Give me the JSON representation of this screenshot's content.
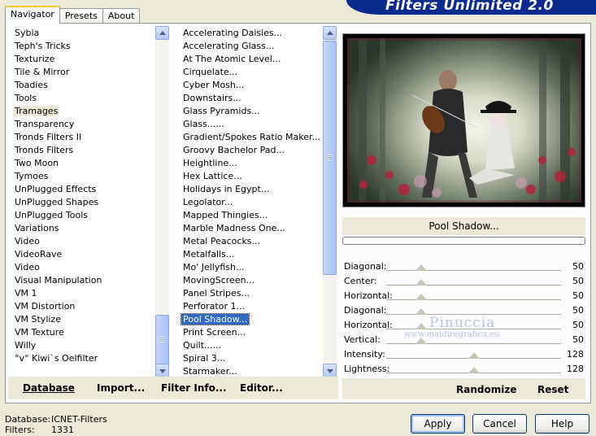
{
  "banner": {
    "title": "Filters Unlimited 2.0"
  },
  "tabs": [
    "Navigator",
    "Presets",
    "About"
  ],
  "categories": [
    "Sybia",
    "Teph's Tricks",
    "Texturize",
    "Tile & Mirror",
    "Toadies",
    "Tools",
    "Tramages",
    "Transparency",
    "Tronds Filters II",
    "Tronds Filters",
    "Two Moon",
    "Tymoes",
    "UnPlugged Effects",
    "UnPlugged Shapes",
    "UnPlugged Tools",
    "Variations",
    "Video",
    "VideoRave",
    "Video",
    "Visual Manipulation",
    "VM 1",
    "VM Distortion",
    "VM Stylize",
    "VM Texture",
    "Willy",
    "°v° Kiwi`s Oelfilter"
  ],
  "selected_category": "Tramages",
  "filters": [
    "Accelerating Daisies...",
    "Accelerating Glass...",
    "At The Atomic Level...",
    "Cirquelate...",
    "Cyber Mosh...",
    "Downstairs...",
    "Glass Pyramids...",
    "Glass......",
    "Gradient/Spokes Ratio Maker...",
    "Groovy Bachelor Pad...",
    "Heightline...",
    "Hex Lattice...",
    "Holidays in Egypt...",
    "Legolator...",
    "Mapped Thingies...",
    "Marble Madness One...",
    "Metal Peacocks...",
    "Metalfalls...",
    "Mo' Jellyfish...",
    "MovingScreen...",
    "Panel Stripes...",
    "Perforator 1...",
    "Pool Shadow...",
    "Print Screen...",
    "Quilt......",
    "Spiral 3...",
    "Starmaker..."
  ],
  "selected_filter": "Pool Shadow...",
  "left_buttons": {
    "database": "Database",
    "import": "Import...",
    "filter_info": "Filter Info...",
    "editor": "Editor..."
  },
  "preview": {
    "filter_name": "Pool Shadow..."
  },
  "params": [
    {
      "label": "Diagonal:",
      "value": "50",
      "level": 0.2
    },
    {
      "label": "Center:",
      "value": "50",
      "level": 0.2
    },
    {
      "label": "Horizontal:",
      "value": "50",
      "level": 0.2
    },
    {
      "label": "Diagonal:",
      "value": "50",
      "level": 0.2
    },
    {
      "label": "Horizontal:",
      "value": "50",
      "level": 0.2
    },
    {
      "label": "Vertical:",
      "value": "50",
      "level": 0.2
    },
    {
      "label": "Intensity:",
      "value": "128",
      "level": 0.5
    },
    {
      "label": "Lightness:",
      "value": "128",
      "level": 0.5
    }
  ],
  "right_buttons": {
    "randomize": "Randomize",
    "reset": "Reset"
  },
  "watermark": {
    "line1": "Pinuccia",
    "line2": "www.maidiregrafica.eu"
  },
  "status": {
    "database_label": "Database:",
    "database_value": "ICNET-Filters",
    "filters_label": "Filters:",
    "filters_value": "1331"
  },
  "dialog_buttons": {
    "apply": "Apply",
    "cancel": "Cancel",
    "help": "Help"
  },
  "colors": {
    "selection_blue": "#316ac5",
    "banner_blue": "#0a2a8c",
    "window_bg": "#ece9d8"
  }
}
